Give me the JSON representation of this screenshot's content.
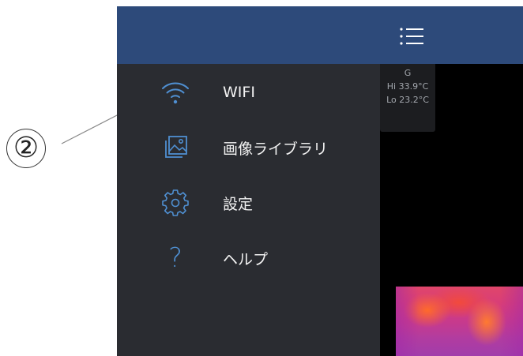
{
  "callout": {
    "number": "②"
  },
  "menu": {
    "items": [
      {
        "label": "WIFI",
        "icon": "wifi-icon"
      },
      {
        "label": "画像ライブラリ",
        "icon": "image-library-icon"
      },
      {
        "label": "設定",
        "icon": "gear-icon"
      },
      {
        "label": "ヘルプ",
        "icon": "help-icon"
      }
    ]
  },
  "help_glyph": "?",
  "temperature": {
    "mode": "G",
    "hi": "Hi 33.9°C",
    "lo": "Lo 23.2°C"
  },
  "colors": {
    "header": "#2d4a7a",
    "drawer_bg": "#2a2c31",
    "icon_accent": "#4f8fd1",
    "main_bg": "#000000"
  }
}
